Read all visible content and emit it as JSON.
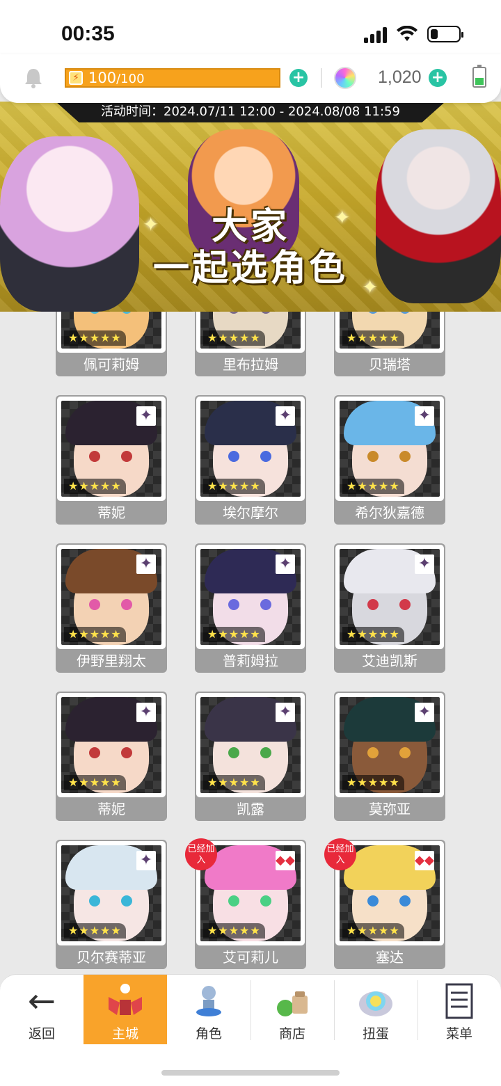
{
  "status_bar": {
    "time": "00:35"
  },
  "resources": {
    "stamina_current": "100",
    "stamina_max": "/100",
    "gem_count": "1,020"
  },
  "banner": {
    "event_time": "活动时间：2024.07/11 12:00 - 2024.08/08 11:59",
    "title_line1": "大家",
    "title_line2": "一起选角色"
  },
  "characters": [
    {
      "name": "佩可莉姆",
      "stars": "★★★★★"
    },
    {
      "name": "里布拉姆",
      "stars": "★★★★★"
    },
    {
      "name": "贝瑞塔",
      "stars": "★★★★★"
    },
    {
      "name": "蒂妮",
      "stars": "★★★★★"
    },
    {
      "name": "埃尔摩尔",
      "stars": "★★★★★"
    },
    {
      "name": "希尔狄嘉德",
      "stars": "★★★★★"
    },
    {
      "name": "伊野里翔太",
      "stars": "★★★★★"
    },
    {
      "name": "普莉姆拉",
      "stars": "★★★★★"
    },
    {
      "name": "艾迪凯斯",
      "stars": "★★★★★"
    },
    {
      "name": "蒂妮",
      "stars": "★★★★★"
    },
    {
      "name": "凯露",
      "stars": "★★★★★"
    },
    {
      "name": "莫弥亚",
      "stars": "★★★★★"
    },
    {
      "name": "贝尔赛蒂亚",
      "stars": "★★★★★"
    },
    {
      "name": "艾可莉儿",
      "stars": "★★★★★",
      "badge": "已经加入"
    },
    {
      "name": "塞达",
      "stars": "★★★★★",
      "badge": "已经加入"
    }
  ],
  "bottom_nav": {
    "back": "返回",
    "main": "主城",
    "character": "角色",
    "shop": "商店",
    "gacha": "扭蛋",
    "menu": "菜单"
  }
}
